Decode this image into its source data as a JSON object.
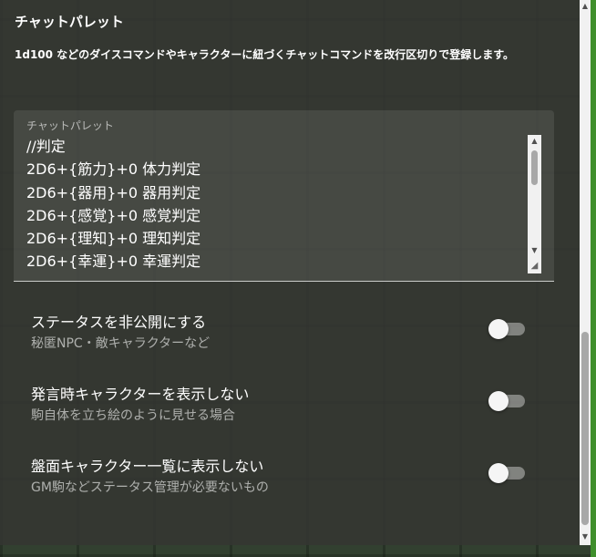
{
  "section": {
    "title": "チャットパレット",
    "description": "1d100 などのダイスコマンドやキャラクターに紐づくチャットコマンドを改行区切りで登録します。"
  },
  "chat_palette": {
    "label": "チャットパレット",
    "lines": [
      "//判定",
      "2D6+{筋力}+0 体力判定",
      "2D6+{器用}+0 器用判定",
      "2D6+{感覚}+0 感覚判定",
      "2D6+{理知}+0 理知判定",
      "2D6+{幸運}+0 幸運判定"
    ]
  },
  "settings": [
    {
      "title": "ステータスを非公開にする",
      "subtitle": "秘匿NPC・敵キャラクターなど",
      "enabled": false
    },
    {
      "title": "発言時キャラクターを表示しない",
      "subtitle": "駒自体を立ち絵のように見せる場合",
      "enabled": false
    },
    {
      "title": "盤面キャラクター一覧に表示しない",
      "subtitle": "GM駒などステータス管理が必要ないもの",
      "enabled": false
    }
  ],
  "icons": {
    "scroll_up": "triangle-up-icon",
    "scroll_down": "triangle-down-icon",
    "resize": "resize-grip-icon"
  },
  "colors": {
    "panel_background": "#343632",
    "board_background": "#324030",
    "switch_thumb_off": "#f5f5f5"
  }
}
